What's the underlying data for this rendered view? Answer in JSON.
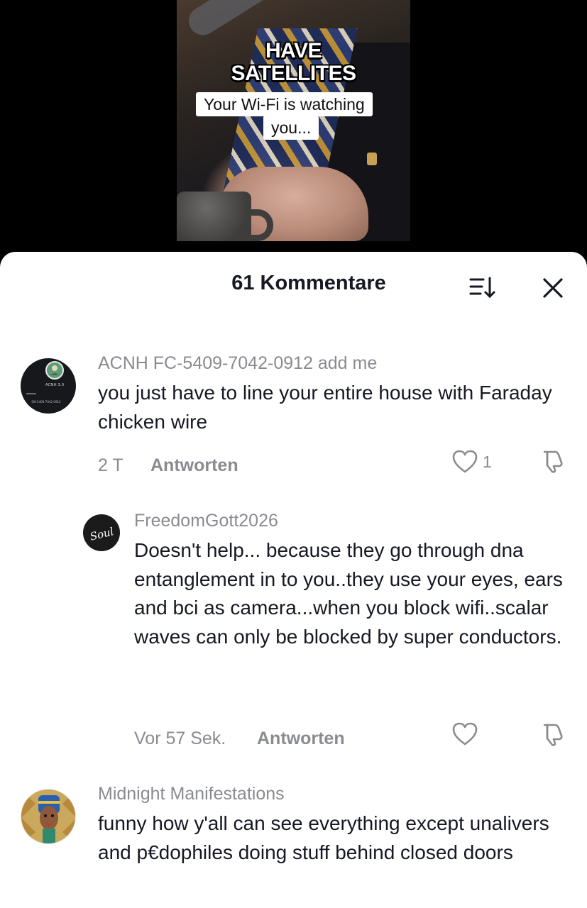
{
  "video": {
    "overlay_line1": "HAVE",
    "overlay_line2": "SATELLITES",
    "caption_line1": "Your Wi-Fi is watching",
    "caption_line2": "you..."
  },
  "sheet": {
    "title": "61 Kommentare",
    "sort_icon": "sort-icon",
    "close_icon": "close-icon"
  },
  "comments": [
    {
      "username": "ACNH FC-5409-7042-0912 add me",
      "text": "you just have to line your entire house with Faraday chicken wire",
      "time": "2 T",
      "reply_label": "Antworten",
      "likes": "1",
      "avatar_text": "ACNH 3.0",
      "avatar_subtext": "SW-5409-7042-0912"
    },
    {
      "username": "FreedomGott2026",
      "text": "Doesn't help... because they go through dna entanglement in to you..they use your eyes, ears and bci as camera...when you block wifi..scalar waves can only be blocked by super conductors.",
      "time": "Vor 57 Sek.",
      "reply_label": "Antworten",
      "avatar_text": "Soul"
    },
    {
      "username": "Midnight Manifestations",
      "text": "funny how y'all can see everything except unalivers and p€dophiles doing stuff behind closed doors"
    }
  ],
  "colors": {
    "text_primary": "#161823",
    "text_secondary": "#8a8b91",
    "background": "#ffffff"
  }
}
